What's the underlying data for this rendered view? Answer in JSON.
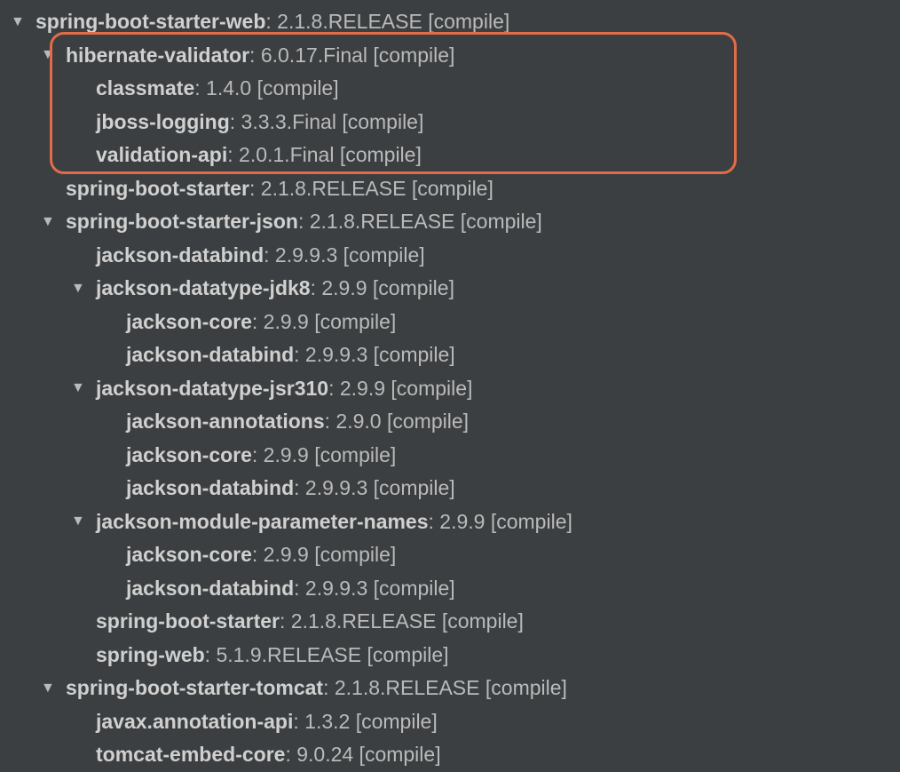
{
  "tree": [
    {
      "level": 0,
      "arrow": true,
      "name": "spring-boot-starter-web",
      "version": "2.1.8.RELEASE",
      "scope": "compile"
    },
    {
      "level": 1,
      "arrow": true,
      "name": "hibernate-validator",
      "version": "6.0.17.Final",
      "scope": "compile"
    },
    {
      "level": 2,
      "arrow": false,
      "name": "classmate",
      "version": "1.4.0",
      "scope": "compile"
    },
    {
      "level": 2,
      "arrow": false,
      "name": "jboss-logging",
      "version": "3.3.3.Final",
      "scope": "compile"
    },
    {
      "level": 2,
      "arrow": false,
      "name": "validation-api",
      "version": "2.0.1.Final",
      "scope": "compile"
    },
    {
      "level": 1,
      "arrow": false,
      "name": "spring-boot-starter",
      "version": "2.1.8.RELEASE",
      "scope": "compile"
    },
    {
      "level": 1,
      "arrow": true,
      "name": "spring-boot-starter-json",
      "version": "2.1.8.RELEASE",
      "scope": "compile"
    },
    {
      "level": 2,
      "arrow": false,
      "name": "jackson-databind",
      "version": "2.9.9.3",
      "scope": "compile"
    },
    {
      "level": 2,
      "arrow": true,
      "name": "jackson-datatype-jdk8",
      "version": "2.9.9",
      "scope": "compile"
    },
    {
      "level": 3,
      "arrow": false,
      "name": "jackson-core",
      "version": "2.9.9",
      "scope": "compile"
    },
    {
      "level": 3,
      "arrow": false,
      "name": "jackson-databind",
      "version": "2.9.9.3",
      "scope": "compile"
    },
    {
      "level": 2,
      "arrow": true,
      "name": "jackson-datatype-jsr310",
      "version": "2.9.9",
      "scope": "compile"
    },
    {
      "level": 3,
      "arrow": false,
      "name": "jackson-annotations",
      "version": "2.9.0",
      "scope": "compile"
    },
    {
      "level": 3,
      "arrow": false,
      "name": "jackson-core",
      "version": "2.9.9",
      "scope": "compile"
    },
    {
      "level": 3,
      "arrow": false,
      "name": "jackson-databind",
      "version": "2.9.9.3",
      "scope": "compile"
    },
    {
      "level": 2,
      "arrow": true,
      "name": "jackson-module-parameter-names",
      "version": "2.9.9",
      "scope": "compile"
    },
    {
      "level": 3,
      "arrow": false,
      "name": "jackson-core",
      "version": "2.9.9",
      "scope": "compile"
    },
    {
      "level": 3,
      "arrow": false,
      "name": "jackson-databind",
      "version": "2.9.9.3",
      "scope": "compile"
    },
    {
      "level": 2,
      "arrow": false,
      "name": "spring-boot-starter",
      "version": "2.1.8.RELEASE",
      "scope": "compile"
    },
    {
      "level": 2,
      "arrow": false,
      "name": "spring-web",
      "version": "5.1.9.RELEASE",
      "scope": "compile"
    },
    {
      "level": 1,
      "arrow": true,
      "name": "spring-boot-starter-tomcat",
      "version": "2.1.8.RELEASE",
      "scope": "compile"
    },
    {
      "level": 2,
      "arrow": false,
      "name": "javax.annotation-api",
      "version": "1.3.2",
      "scope": "compile"
    },
    {
      "level": 2,
      "arrow": false,
      "name": "tomcat-embed-core",
      "version": "9.0.24",
      "scope": "compile"
    }
  ]
}
